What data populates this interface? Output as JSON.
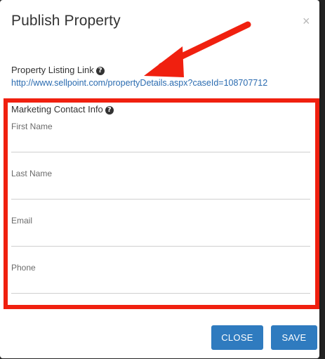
{
  "dialog": {
    "title": "Publish Property",
    "close_icon": "×"
  },
  "listing": {
    "label": "Property Listing Link",
    "help_icon": "?",
    "url": "http://www.sellpoint.com/propertyDetails.aspx?caseId=108707712"
  },
  "marketing": {
    "label": "Marketing Contact Info",
    "help_icon": "?",
    "fields": [
      {
        "label": "First Name",
        "value": ""
      },
      {
        "label": "Last Name",
        "value": ""
      },
      {
        "label": "Email",
        "value": ""
      },
      {
        "label": "Phone",
        "value": ""
      }
    ]
  },
  "footer": {
    "close_label": "CLOSE",
    "save_label": "SAVE"
  },
  "colors": {
    "accent": "#2f7bbf",
    "annotation": "#f0200f",
    "link": "#2a6bb0"
  },
  "icons": [
    "close-icon",
    "help-icon",
    "help-icon"
  ]
}
